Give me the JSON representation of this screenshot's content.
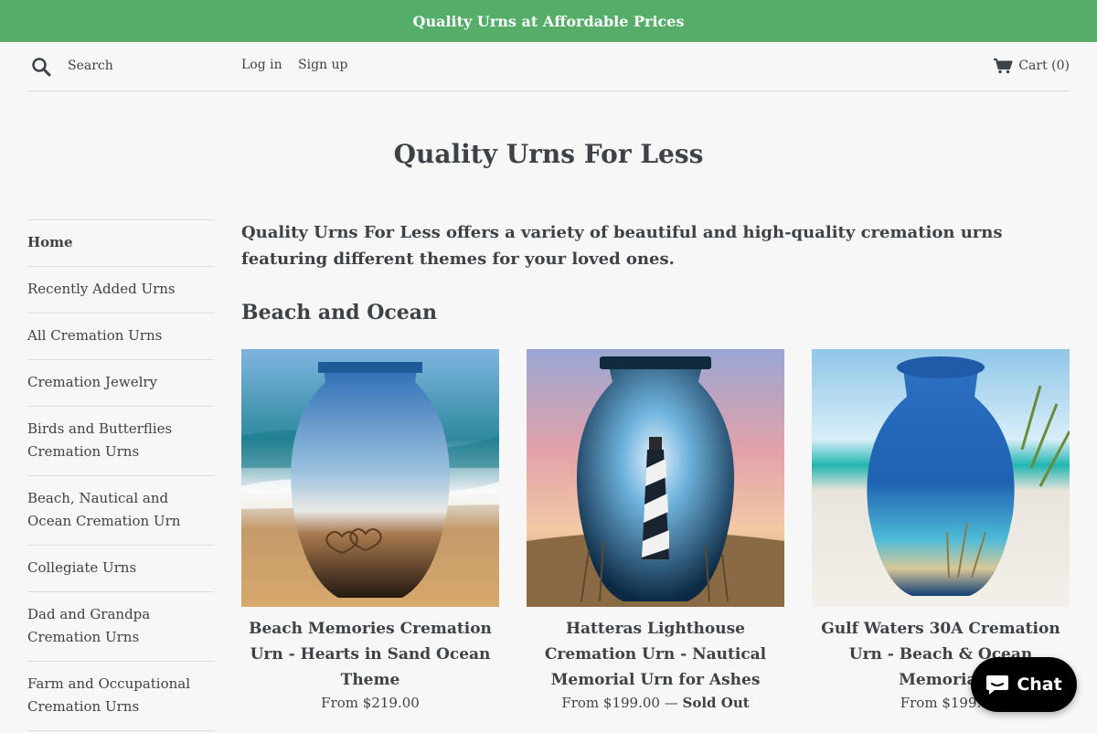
{
  "announcement": "Quality Urns at Affordable Prices",
  "header": {
    "search_placeholder": "Search",
    "login": "Log in",
    "signup": "Sign up",
    "cart": "Cart (0)"
  },
  "site_title": "Quality Urns For Less",
  "sidebar": {
    "items": [
      {
        "label": "Home"
      },
      {
        "label": "Recently Added Urns"
      },
      {
        "label": "All Cremation Urns"
      },
      {
        "label": "Cremation Jewelry"
      },
      {
        "label": "Birds and Butterflies Cremation Urns"
      },
      {
        "label": "Beach, Nautical and Ocean Cremation Urn"
      },
      {
        "label": "Collegiate Urns"
      },
      {
        "label": "Dad and Grandpa Cremation Urns"
      },
      {
        "label": "Farm and Occupational Cremation Urns"
      }
    ]
  },
  "intro": "Quality Urns For Less offers a variety of beautiful and high-quality cremation urns featuring different themes for your loved ones.",
  "section_title": "Beach and Ocean",
  "products": [
    {
      "title": "Beach Memories Cremation Urn - Hearts in Sand Ocean Theme",
      "price": "From $219.00",
      "status": ""
    },
    {
      "title": "Hatteras Lighthouse Cremation Urn - Nautical Memorial Urn for Ashes",
      "price": "From $199.00 —",
      "status": "Sold Out"
    },
    {
      "title": "Gulf Waters 30A Cremation Urn - Beach & Ocean Memorial",
      "price": "From $199.",
      "status": ""
    }
  ],
  "chat": {
    "label": "Chat"
  },
  "colors": {
    "announcement_bg": "#56ad6a",
    "text": "#3d4246",
    "chat_bg": "#000000"
  }
}
